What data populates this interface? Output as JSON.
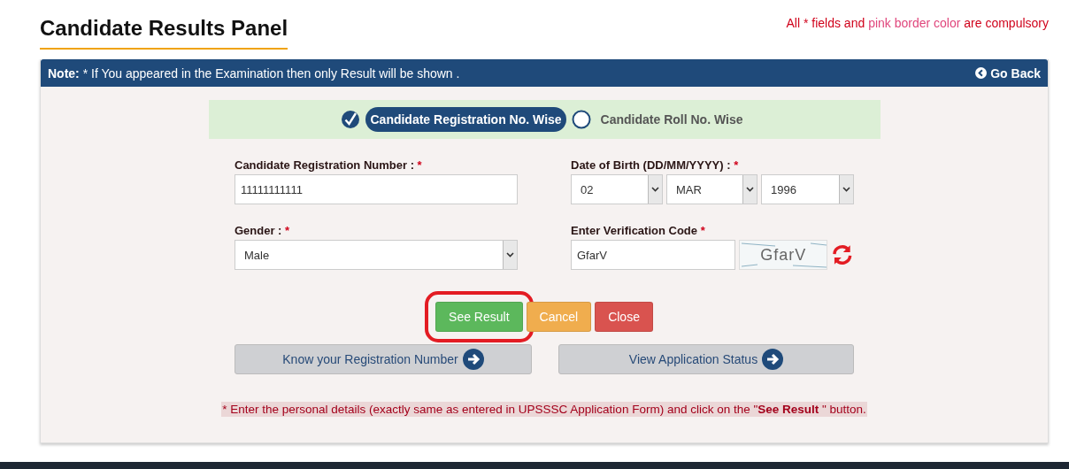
{
  "page_title": "Candidate Results Panel",
  "compulsory_note": {
    "prefix": "All * fields and",
    "highlight": "pink border color",
    "suffix": "are compulsory"
  },
  "panel_header": {
    "note_label": "Note:",
    "note_text": "* If You appeared in the Examination then only Result will be shown .",
    "back_link": "Go Back"
  },
  "search_modes": [
    {
      "label": "Candidate Registration No. Wise",
      "selected": true
    },
    {
      "label": "Candidate Roll No. Wise",
      "selected": false
    }
  ],
  "fields": {
    "registration": {
      "label": "Candidate Registration Number :",
      "required_mark": "*",
      "value": "11111111111"
    },
    "dob": {
      "label": "Date of Birth (DD/MM/YYYY) :",
      "required_mark": "*",
      "day": "02",
      "month": "MAR",
      "year": "1996"
    },
    "gender": {
      "label": "Gender :",
      "required_mark": "*",
      "value": "Male"
    },
    "verification": {
      "label": "Enter Verification Code",
      "required_mark": "*",
      "value": "GfarV",
      "captcha_text": "GfarV"
    }
  },
  "actions": [
    {
      "kind": "success",
      "label": "See Result",
      "highlighted": true
    },
    {
      "kind": "warning",
      "label": "Cancel",
      "highlighted": false
    },
    {
      "kind": "danger",
      "label": "Close",
      "highlighted": false
    }
  ],
  "links": [
    {
      "label": "Know your Registration Number"
    },
    {
      "label": "View Application Status"
    }
  ],
  "footnote": "* Enter the personal details (exactly same as entered in UPSSSC Application Form) and click on the \"**See Result** \" button."
}
